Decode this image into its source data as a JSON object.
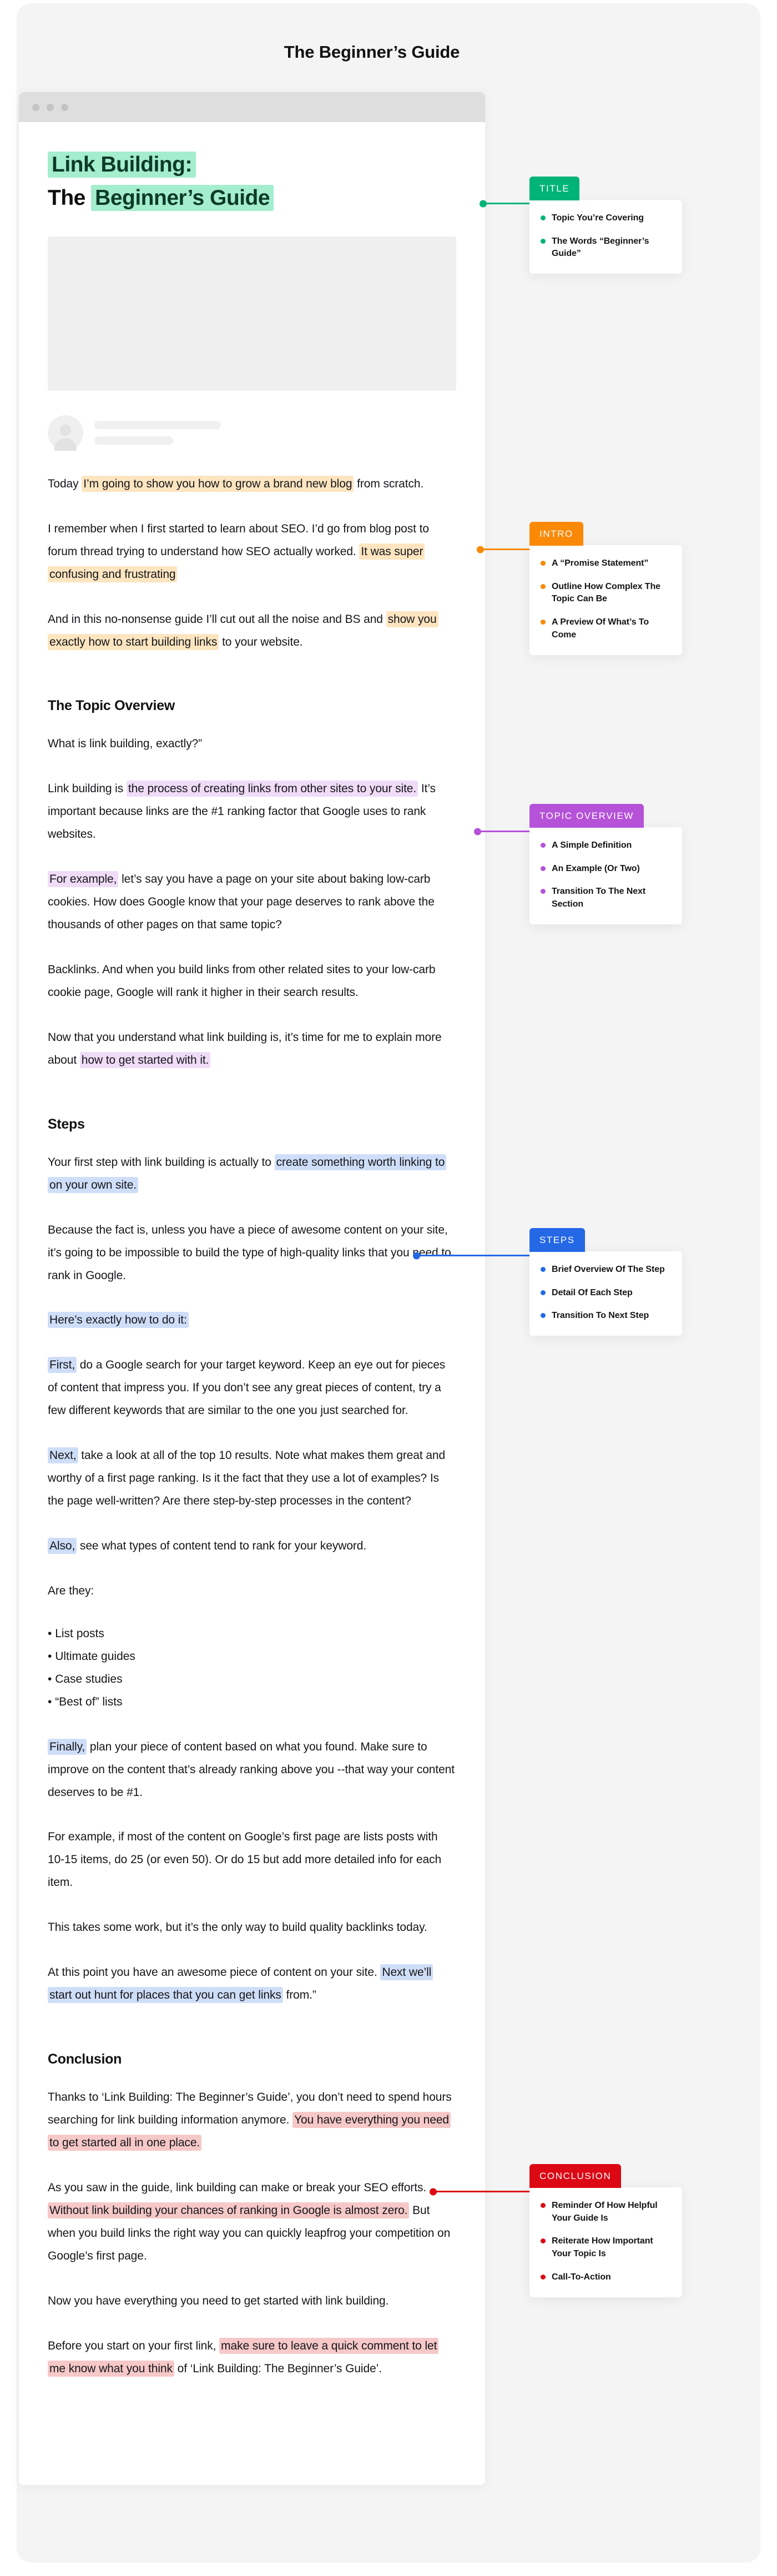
{
  "page": {
    "title": "The Beginner’s Guide"
  },
  "browser": {
    "dots": 3
  },
  "article": {
    "headline": {
      "line1": "Link Building:",
      "line2_plain": "The ",
      "line2_highlight": "Beginner’s Guide"
    },
    "paragraphs": [
      {
        "id": "intro-1",
        "parts": [
          {
            "t": "Today ",
            "h": null
          },
          {
            "t": "I’m going to show you how to grow a brand new blog",
            "h": "orange"
          },
          {
            "t": " from scratch.",
            "h": null
          }
        ]
      },
      {
        "id": "intro-2",
        "parts": [
          {
            "t": "I remember when I first started to learn about SEO. I’d go from blog post to forum thread trying to understand how SEO actually worked. ",
            "h": null
          },
          {
            "t": "It was super confusing and frustrating",
            "h": "orange"
          }
        ]
      },
      {
        "id": "intro-3",
        "parts": [
          {
            "t": "And in this no-nonsense guide I’ll cut out all the noise and BS and ",
            "h": null
          },
          {
            "t": "show you exactly how to start building links",
            "h": "orange"
          },
          {
            "t": " to your website.",
            "h": null
          }
        ]
      }
    ],
    "section_topic_overview": {
      "heading": "The Topic Overview",
      "paragraphs": [
        {
          "id": "to-1",
          "parts": [
            {
              "t": "What is link building, exactly?”",
              "h": null
            }
          ]
        },
        {
          "id": "to-2",
          "parts": [
            {
              "t": "Link building is ",
              "h": null
            },
            {
              "t": "the process of creating links from other sites to your site.",
              "h": "purple"
            },
            {
              "t": " It’s important because links are the #1 ranking factor that Google uses to rank websites.",
              "h": null
            }
          ]
        },
        {
          "id": "to-3",
          "parts": [
            {
              "t": "For example,",
              "h": "purple"
            },
            {
              "t": " let’s say you have a page on your site about baking low-carb cookies. How does Google know that your page deserves to rank above the thousands of other pages on that same topic?",
              "h": null
            }
          ]
        },
        {
          "id": "to-4",
          "parts": [
            {
              "t": "Backlinks. And when you build links from other related sites to your low-carb cookie page, Google will rank it higher in their search results.",
              "h": null
            }
          ]
        },
        {
          "id": "to-5",
          "parts": [
            {
              "t": "Now that you understand what link building is, it’s time for me to explain more about ",
              "h": null
            },
            {
              "t": "how to get started with it.",
              "h": "purple"
            }
          ]
        }
      ]
    },
    "section_steps": {
      "heading": "Steps",
      "paragraphs": [
        {
          "id": "st-1",
          "parts": [
            {
              "t": "Your first step with link building is actually to ",
              "h": null
            },
            {
              "t": "create something worth linking to on your own site.",
              "h": "blue"
            }
          ]
        },
        {
          "id": "st-2",
          "parts": [
            {
              "t": "Because the fact is, unless you have a piece of awesome content on your site, it’s going to be impossible to build the type of high-quality links that you need to rank in Google.",
              "h": null
            }
          ]
        },
        {
          "id": "st-3",
          "parts": [
            {
              "t": "Here’s exactly how to do it:",
              "h": "blue"
            }
          ]
        },
        {
          "id": "st-4",
          "parts": [
            {
              "t": "First,",
              "h": "blue"
            },
            {
              "t": " do a Google search for your target keyword. Keep an eye out for pieces of content that impress you. If you don’t see any great pieces of content, try a few different keywords that are similar to the one you just searched for.",
              "h": null
            }
          ]
        },
        {
          "id": "st-5",
          "parts": [
            {
              "t": "Next,",
              "h": "blue"
            },
            {
              "t": " take a look at all of the top 10 results. Note what makes them great and worthy of a first page ranking. Is it the fact that they use a lot of examples? Is the page well-written? Are there step-by-step processes in the content?",
              "h": null
            }
          ]
        },
        {
          "id": "st-6",
          "parts": [
            {
              "t": "Also,",
              "h": "blue"
            },
            {
              "t": " see what types of content tend to rank for your keyword.",
              "h": null
            }
          ]
        },
        {
          "id": "st-7",
          "parts": [
            {
              "t": "Are they:",
              "h": null
            }
          ]
        }
      ],
      "list": [
        "List posts",
        "Ultimate guides",
        "Case studies",
        "“Best of” lists"
      ],
      "paragraphs_after": [
        {
          "id": "st-8",
          "parts": [
            {
              "t": "Finally,",
              "h": "blue"
            },
            {
              "t": " plan your piece of content based on what you found. Make sure to improve on the content that’s already ranking above you --that way your content deserves to be #1.",
              "h": null
            }
          ]
        },
        {
          "id": "st-9",
          "parts": [
            {
              "t": "For example, if most of the content on Google’s first page are lists posts with 10-15 items, do 25 (or even 50). Or do 15 but add more detailed info for each item.",
              "h": null
            }
          ]
        },
        {
          "id": "st-10",
          "parts": [
            {
              "t": "This takes some work, but it’s the only way to build quality backlinks today.",
              "h": null
            }
          ]
        },
        {
          "id": "st-11",
          "parts": [
            {
              "t": "At this point you have an awesome piece of content on your site. ",
              "h": null
            },
            {
              "t": "Next we’ll start out hunt for places that you can get links",
              "h": "blue"
            },
            {
              "t": " from.”",
              "h": null
            }
          ]
        }
      ]
    },
    "section_conclusion": {
      "heading": "Conclusion",
      "paragraphs": [
        {
          "id": "cn-1",
          "parts": [
            {
              "t": "Thanks to ‘Link Building: The Beginner’s Guide’, you don’t need to spend hours searching for link building information anymore. ",
              "h": null
            },
            {
              "t": "You have everything you need to get started all in one place.",
              "h": "red"
            }
          ]
        },
        {
          "id": "cn-2",
          "parts": [
            {
              "t": "As you saw in the guide, link building can make or break your SEO efforts. ",
              "h": null
            },
            {
              "t": "Without link building your chances of ranking in Google is almost zero.",
              "h": "red"
            },
            {
              "t": " But when you build links the right way you can quickly leapfrog your competition on Google’s first page.",
              "h": null
            }
          ]
        },
        {
          "id": "cn-3",
          "parts": [
            {
              "t": "Now you have everything you need to get started with link building.",
              "h": null
            }
          ]
        },
        {
          "id": "cn-4",
          "parts": [
            {
              "t": "Before you start on your first link, ",
              "h": null
            },
            {
              "t": "make sure to leave a quick comment to let me know what you think",
              "h": "red"
            },
            {
              "t": " of ‘Link Building: The Beginner’s Guide’.",
              "h": null
            }
          ]
        }
      ]
    }
  },
  "annotations": [
    {
      "id": "title",
      "label": "TITLE",
      "color": "#00b377",
      "items": [
        "Topic You’re Covering",
        "The Words “Beginner’s Guide”"
      ]
    },
    {
      "id": "intro",
      "label": "INTRO",
      "color": "#f98907",
      "items": [
        "A “Promise Statement”",
        "Outline How Complex The Topic Can Be",
        "A Preview Of What’s To Come"
      ]
    },
    {
      "id": "topic-overview",
      "label": "TOPIC OVERVIEW",
      "color": "#b552d8",
      "items": [
        "A Simple Definition",
        "An Example (Or Two)",
        "Transition To The Next Section"
      ]
    },
    {
      "id": "steps",
      "label": "STEPS",
      "color": "#2468e6",
      "items": [
        "Brief Overview Of The Step",
        "Detail Of Each Step",
        "Transition To Next Step"
      ]
    },
    {
      "id": "conclusion",
      "label": "CONCLUSION",
      "color": "#dc0814",
      "items": [
        "Reminder Of How Helpful Your Guide Is",
        "Reiterate How Important Your Topic Is",
        "Call-To-Action"
      ]
    }
  ],
  "highlight_colors": {
    "title_green": "#a4edcd",
    "intro_orange": "#fde5c0",
    "topic_purple": "#f0dcf7",
    "steps_blue": "#cfdef8",
    "conclusion_red": "#f6c8c8"
  }
}
